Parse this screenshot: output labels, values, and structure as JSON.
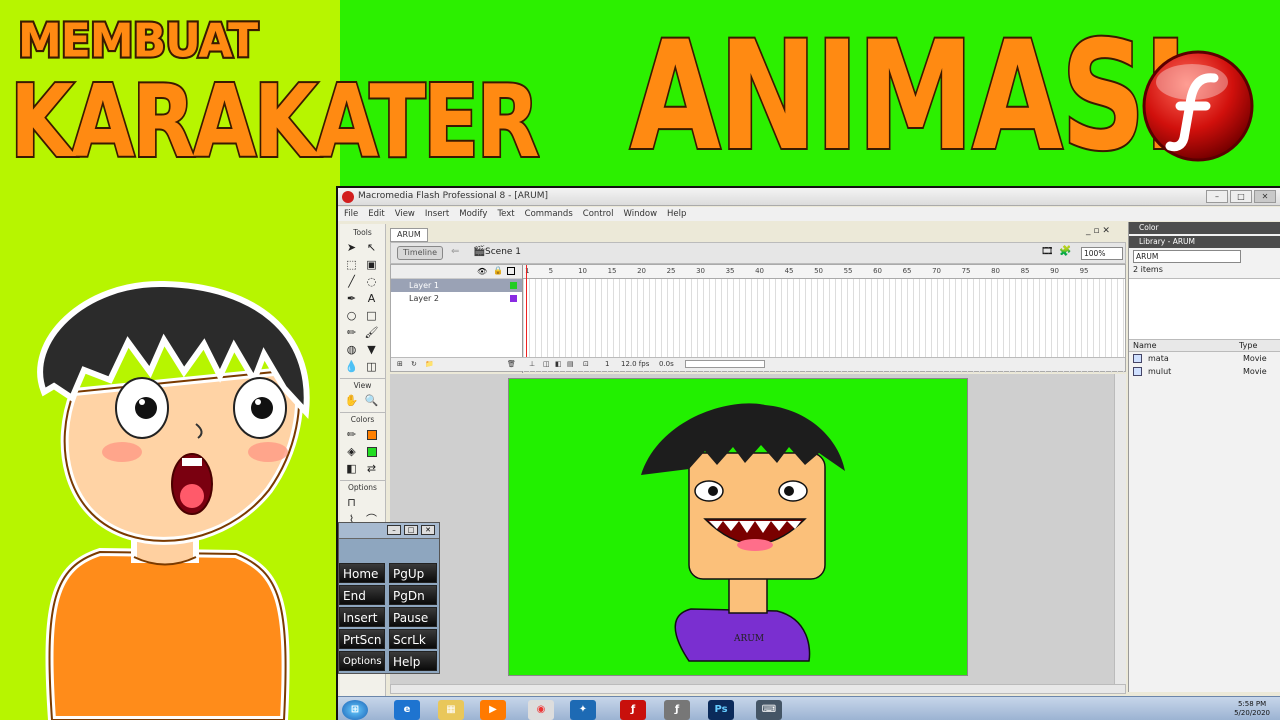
{
  "banner": {
    "line1": "MEMBUAT",
    "line2": "KARAKATER",
    "line3": "ANIMASI"
  },
  "app": {
    "window_title": "Macromedia Flash Professional 8 - [ARUM]",
    "menu": [
      "File",
      "Edit",
      "View",
      "Insert",
      "Modify",
      "Text",
      "Commands",
      "Control",
      "Window",
      "Help"
    ],
    "doc_tab": "ARUM",
    "timeline_button": "Timeline",
    "scene": "Scene 1",
    "zoom": "100%",
    "tools_header": "Tools",
    "view_header": "View",
    "colors_header": "Colors",
    "options_header": "Options",
    "layers": [
      {
        "name": "Layer 1",
        "selected": true,
        "color": "#22cc22"
      },
      {
        "name": "Layer 2",
        "selected": false,
        "color": "#8a2be2"
      }
    ],
    "frame_ruler": [
      "1",
      "5",
      "10",
      "15",
      "20",
      "25",
      "30",
      "35",
      "40",
      "45",
      "50",
      "55",
      "60",
      "65",
      "70",
      "75",
      "80",
      "85",
      "90",
      "95"
    ],
    "current_frame": "1",
    "fps": "12.0 fps",
    "elapsed": "0.0s",
    "stage_color": "#22f000",
    "character_shirt_text": "ARUM"
  },
  "panels": {
    "color_header": "Color",
    "library_header": "Library - ARUM",
    "library_select": "ARUM",
    "item_count": "2 items",
    "col_name": "Name",
    "col_type": "Type",
    "items": [
      {
        "name": "mata",
        "type": "Movie"
      },
      {
        "name": "mulut",
        "type": "Movie"
      }
    ]
  },
  "taskbar": {
    "time": "5:58 PM",
    "date": "5/20/2020"
  },
  "osk": {
    "keys": [
      "Home",
      "PgUp",
      "End",
      "PgDn",
      "Insert",
      "Pause",
      "PrtScn",
      "ScrLk",
      "Options",
      "Help"
    ]
  }
}
